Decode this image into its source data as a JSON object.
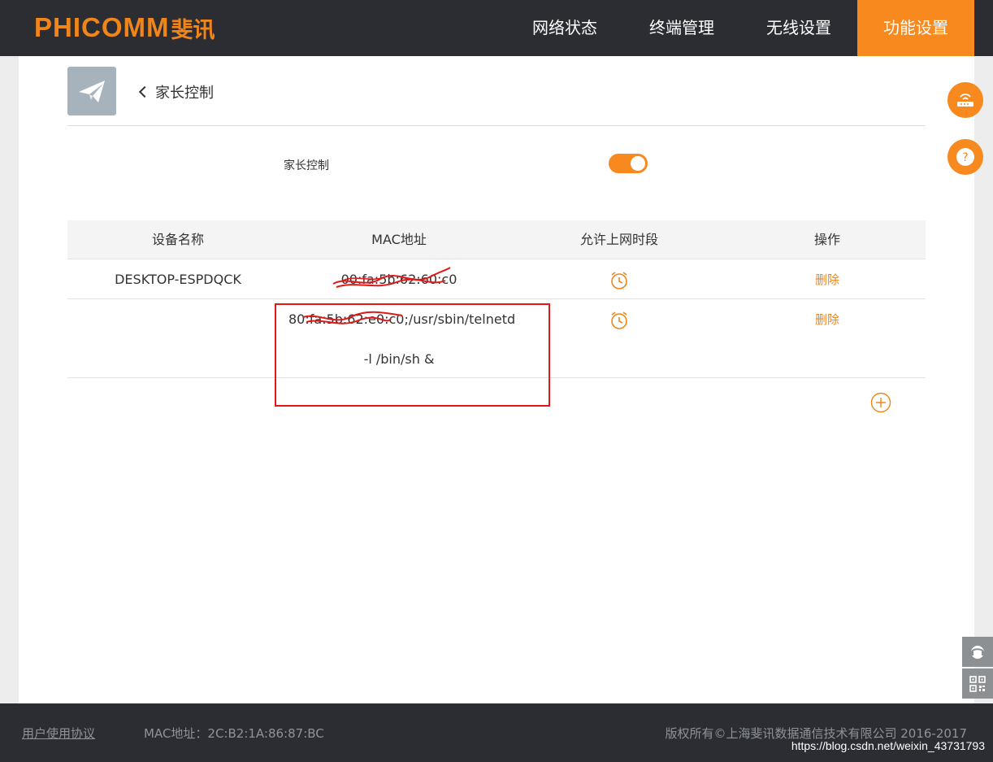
{
  "header": {
    "brand_en": "PHICOMM",
    "brand_cn": "斐讯",
    "nav": [
      {
        "label": "网络状态"
      },
      {
        "label": "终端管理"
      },
      {
        "label": "无线设置"
      },
      {
        "label": "功能设置",
        "active": true
      }
    ]
  },
  "page": {
    "back_label": "家长控制",
    "tool_icon": "paper-plane-icon"
  },
  "parental_control": {
    "label": "家长控制",
    "enabled": true
  },
  "table": {
    "headers": [
      "设备名称",
      "MAC地址",
      "允许上网时段",
      "操作"
    ],
    "rows": [
      {
        "device": "DESKTOP-ESPDQCK",
        "mac": "00:fa:5b:62:60:c0",
        "schedule_icon": "alarm-clock-icon",
        "action": "删除"
      },
      {
        "device": "",
        "mac_line1": "80:fa:5b:62:e0:c0;/usr/sbin/telnetd",
        "mac_line2": "-l /bin/sh &",
        "schedule_icon": "alarm-clock-icon",
        "action": "删除"
      }
    ],
    "add_icon": "plus-circle-icon"
  },
  "sidebar": {
    "router_icon": "router-icon",
    "help_icon": "question-icon",
    "service_icon": "headset-icon",
    "qr_icon": "qr-code-icon"
  },
  "footer": {
    "agreement": "用户使用协议",
    "mac": "MAC地址：2C:B2:1A:86:87:BC",
    "copyright": "版权所有©上海斐讯数据通信技术有限公司 2016-2017",
    "watermark": "https://blog.csdn.net/weixin_43731793"
  },
  "colors": {
    "accent": "#f7891f",
    "header_bg": "#2b2d33",
    "annotation_red": "#e01818"
  }
}
